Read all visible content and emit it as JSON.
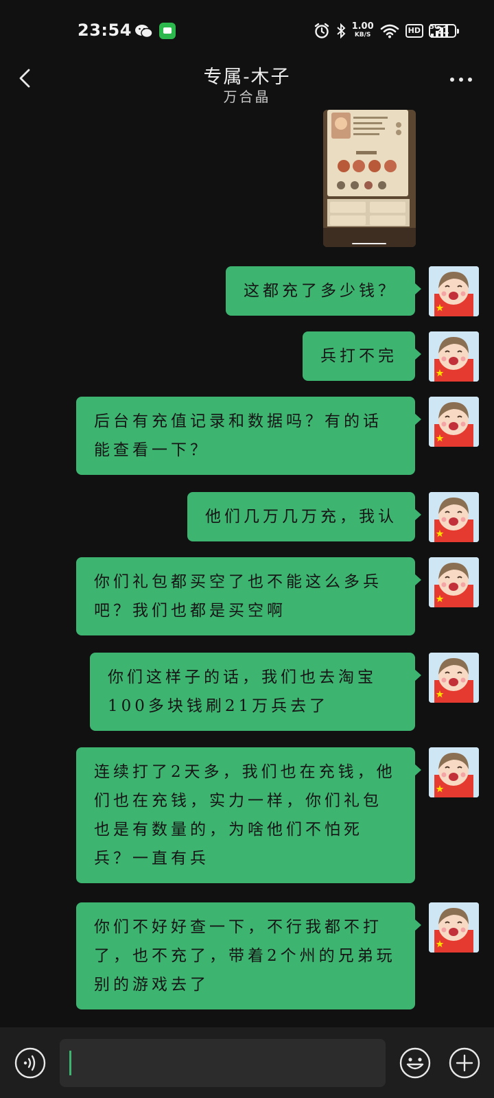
{
  "status_bar": {
    "time": "23:54",
    "net_speed_value": "1.00",
    "net_speed_unit": "KB/S",
    "hd": "HD",
    "signal": "5G",
    "battery": "21",
    "icons": [
      "wechat-icon",
      "messages-app-icon",
      "alarm-icon",
      "bluetooth-icon",
      "wifi-icon",
      "signal-icon",
      "battery-icon"
    ]
  },
  "nav": {
    "title": "专属-木子",
    "subtitle": "万合晶",
    "icons": [
      "chevron-left-icon",
      "more-dots-icon"
    ]
  },
  "messages": [
    {
      "type": "image",
      "from": "other"
    },
    {
      "type": "text",
      "from": "me",
      "text": "这都充了多少钱？"
    },
    {
      "type": "text",
      "from": "me",
      "text": "兵打不完"
    },
    {
      "type": "text",
      "from": "me",
      "text": "后台有充值记录和数据吗？有的话能查看一下？"
    },
    {
      "type": "text",
      "from": "me",
      "text": "他们几万几万充，我认"
    },
    {
      "type": "text",
      "from": "me",
      "text": "你们礼包都买空了也不能这么多兵吧？我们也都是买空啊"
    },
    {
      "type": "text",
      "from": "me",
      "text": "你们这样子的话，我们也去淘宝100多块钱刷21万兵去了"
    },
    {
      "type": "text",
      "from": "me",
      "text": "连续打了2天多，我们也在充钱，他们也在充钱，实力一样，你们礼包也是有数量的，为啥他们不怕死兵？一直有兵"
    },
    {
      "type": "text",
      "from": "me",
      "text": "你们不好好查一下，不行我都不打了，也不充了，带着2个州的兄弟玩别的游戏去了"
    }
  ],
  "composer": {
    "input_value": "",
    "icons": [
      "voice-icon",
      "emoji-icon",
      "plus-icon"
    ]
  },
  "colors": {
    "background": "#111111",
    "bubble": "#3eb471",
    "bottom_bar": "#1e1e1e",
    "input": "#2c2c2c"
  }
}
